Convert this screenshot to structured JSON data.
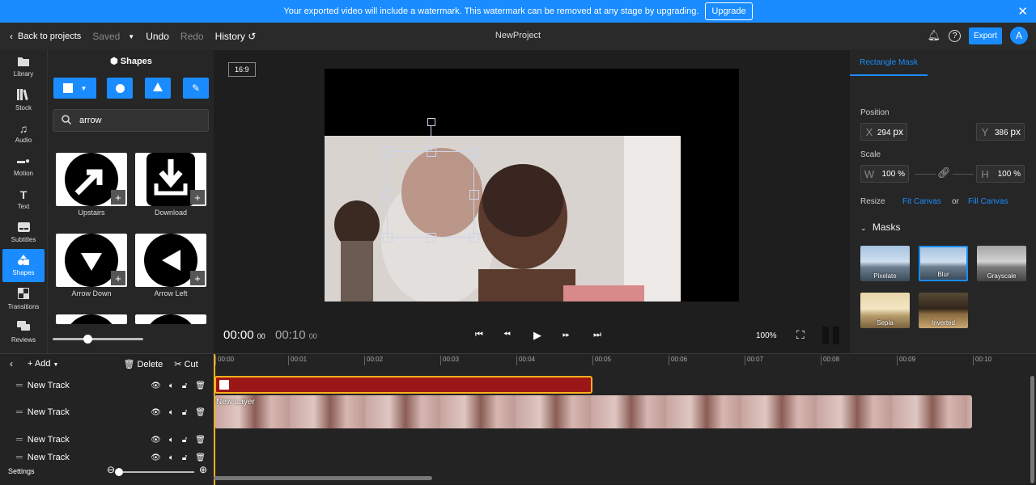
{
  "banner": {
    "text": "Your exported video will include a watermark. This watermark can be removed at any stage by upgrading.",
    "upgrade_label": "Upgrade"
  },
  "topbar": {
    "back_label": "Back to projects",
    "saved_label": "Saved",
    "undo_label": "Undo",
    "redo_label": "Redo",
    "history_label": "History",
    "project_name": "NewProject",
    "export_label": "Export",
    "avatar_initial": "A"
  },
  "sidebar": {
    "items": [
      {
        "label": "Library",
        "icon": "folder-icon"
      },
      {
        "label": "Stock",
        "icon": "books-icon"
      },
      {
        "label": "Audio",
        "icon": "music-note-icon"
      },
      {
        "label": "Motion",
        "icon": "motion-icon"
      },
      {
        "label": "Text",
        "icon": "text-icon"
      },
      {
        "label": "Subtitles",
        "icon": "subtitles-icon"
      },
      {
        "label": "Shapes",
        "icon": "shapes-icon",
        "active": true
      },
      {
        "label": "Transitions",
        "icon": "transitions-icon"
      },
      {
        "label": "Reviews",
        "icon": "chat-icon"
      }
    ]
  },
  "shapes_panel": {
    "title": "Shapes",
    "search_value": "arrow",
    "tiles": [
      {
        "label": "Upstairs"
      },
      {
        "label": "Download"
      },
      {
        "label": "Arrow Down"
      },
      {
        "label": "Arrow Left"
      }
    ],
    "zoom_slider_value": 0.38
  },
  "preview": {
    "aspect_ratio": "16:9",
    "current_time": "00:00",
    "current_frames": "00",
    "total_time": "00:10",
    "total_frames": "00",
    "zoom": "100%"
  },
  "inspector": {
    "tab_label": "Rectangle Mask",
    "position_label": "Position",
    "x_prefix": "X",
    "x_value": "294",
    "x_unit": "px",
    "y_prefix": "Y",
    "y_value": "386",
    "y_unit": "px",
    "scale_label": "Scale",
    "w_prefix": "W",
    "w_value": "100",
    "w_unit": "%",
    "h_prefix": "H",
    "h_value": "100",
    "h_unit": "%",
    "resize_label": "Resize",
    "fit_canvas_label": "Fit Canvas",
    "or_label": "or",
    "fill_canvas_label": "Fill Canvas",
    "masks_label": "Masks",
    "masks": [
      {
        "label": "Pixelate"
      },
      {
        "label": "Blur",
        "selected": true
      },
      {
        "label": "Grayscale"
      },
      {
        "label": "Sepia"
      },
      {
        "label": "Inverted"
      }
    ]
  },
  "timeline": {
    "add_label": "Add",
    "delete_label": "Delete",
    "cut_label": "Cut",
    "settings_label": "Settings",
    "tracks": [
      {
        "name": "New Track"
      },
      {
        "name": "New Track"
      },
      {
        "name": "New Track"
      },
      {
        "name": "New Track"
      }
    ],
    "layer_label": "New Layer",
    "ruler_ticks": [
      "00:00",
      "00:01",
      "00:02",
      "00:03",
      "00:04",
      "00:05",
      "00:06",
      "00:07",
      "00:08",
      "00:09",
      "00:10"
    ]
  },
  "colors": {
    "accent": "#1a8cff",
    "clip_shape": "#9b1616",
    "playhead": "#ffb020"
  }
}
